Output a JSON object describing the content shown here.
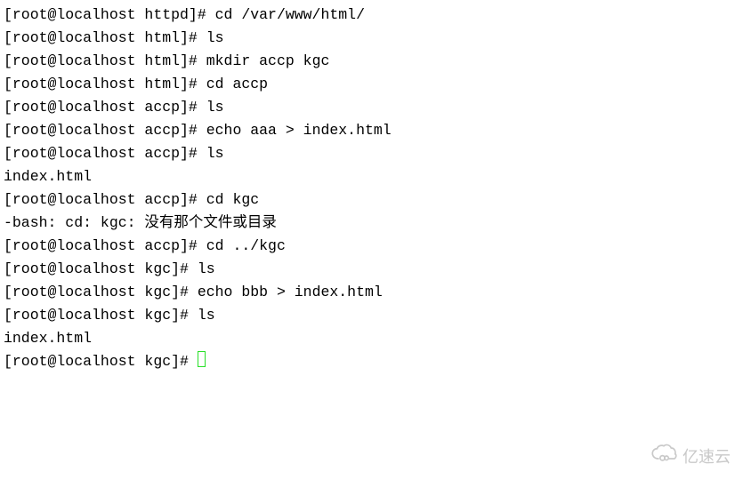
{
  "lines": [
    {
      "prompt": "[root@localhost httpd]# ",
      "cmd": "cd /var/www/html/"
    },
    {
      "prompt": "[root@localhost html]# ",
      "cmd": "ls"
    },
    {
      "prompt": "[root@localhost html]# ",
      "cmd": "mkdir accp kgc"
    },
    {
      "prompt": "[root@localhost html]# ",
      "cmd": "cd accp"
    },
    {
      "prompt": "[root@localhost accp]# ",
      "cmd": "ls"
    },
    {
      "prompt": "[root@localhost accp]# ",
      "cmd": "echo aaa > index.html"
    },
    {
      "prompt": "[root@localhost accp]# ",
      "cmd": "ls"
    },
    {
      "output": "index.html"
    },
    {
      "prompt": "[root@localhost accp]# ",
      "cmd": "cd kgc"
    },
    {
      "output": "-bash: cd: kgc: 没有那个文件或目录"
    },
    {
      "prompt": "[root@localhost accp]# ",
      "cmd": "cd ../kgc"
    },
    {
      "prompt": "[root@localhost kgc]# ",
      "cmd": "ls"
    },
    {
      "prompt": "[root@localhost kgc]# ",
      "cmd": "echo bbb > index.html"
    },
    {
      "prompt": "[root@localhost kgc]# ",
      "cmd": "ls"
    },
    {
      "output": "index.html"
    },
    {
      "prompt": "[root@localhost kgc]# ",
      "cmd": "",
      "cursor": true
    }
  ],
  "watermark": {
    "text": "亿速云"
  }
}
